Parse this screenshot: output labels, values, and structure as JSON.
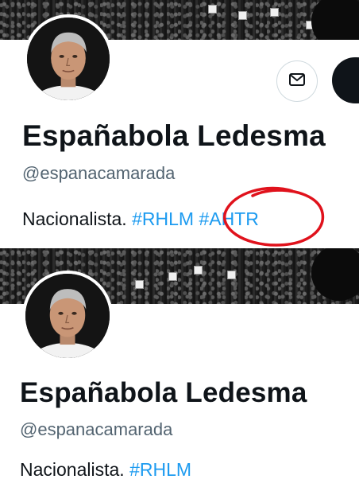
{
  "profiles": [
    {
      "display_name": "Españabola Ledesma",
      "handle": "@espanacamarada",
      "bio_text": "Nacionalista.",
      "hashtags": [
        "#RHLM",
        "#AHTR"
      ]
    },
    {
      "display_name": "Españabola Ledesma",
      "handle": "@espanacamarada",
      "bio_text": "Nacionalista.",
      "hashtags": [
        "#RHLM"
      ]
    }
  ],
  "icons": {
    "message": "envelope-icon",
    "annotation": "red-circle-highlight"
  },
  "colors": {
    "hashtag": "#1d9bf0",
    "name": "#0f1419",
    "handle": "#536471",
    "annotation_circle": "#e0121c",
    "follow_button": "#0f1419"
  }
}
